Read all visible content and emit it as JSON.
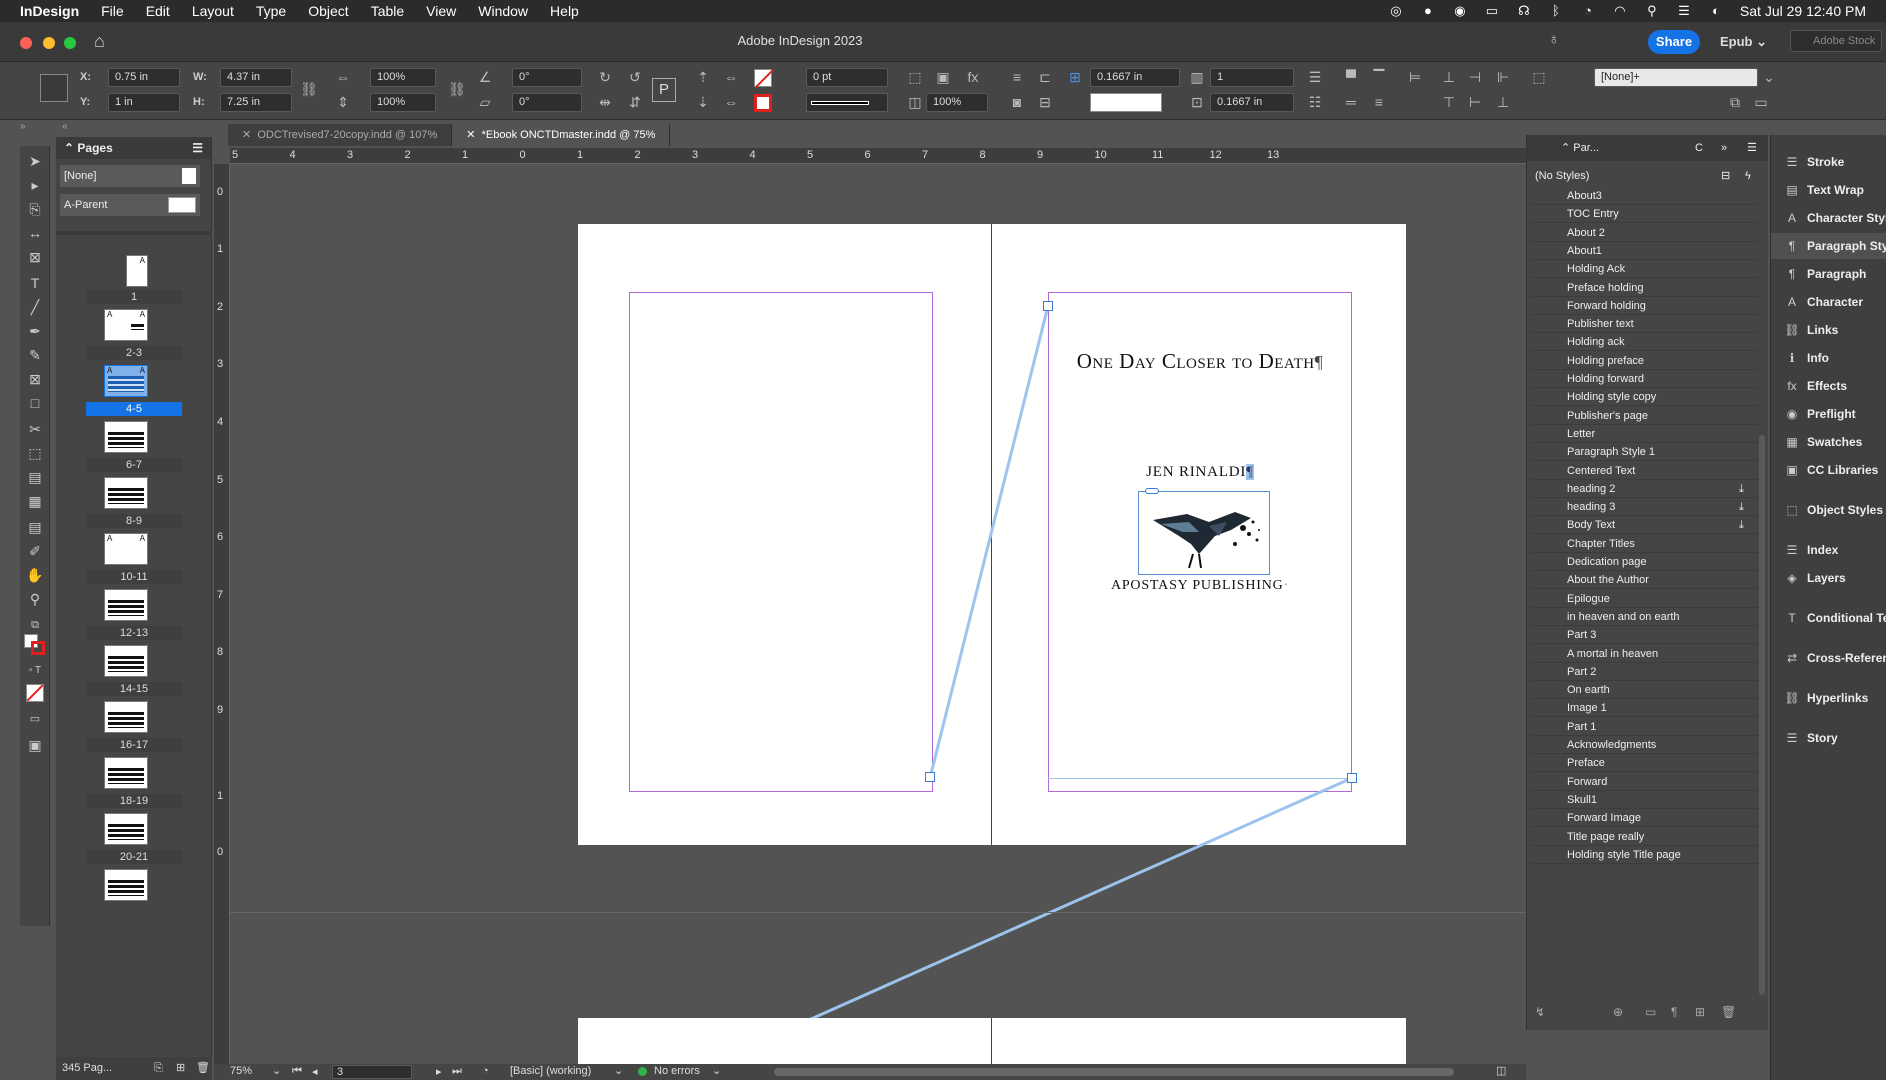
{
  "menubar": {
    "app_name": "InDesign",
    "items": [
      "File",
      "Edit",
      "Layout",
      "Type",
      "Object",
      "Table",
      "View",
      "Window",
      "Help"
    ],
    "datetime": "Sat Jul 29  12:40 PM"
  },
  "titlebar": {
    "title": "Adobe InDesign 2023",
    "share_label": "Share",
    "workspace_label": "Epub",
    "stock_placeholder": "Adobe Stock"
  },
  "control": {
    "x_label": "X:",
    "x_value": "0.75 in",
    "y_label": "Y:",
    "y_value": "1 in",
    "w_label": "W:",
    "w_value": "4.37 in",
    "h_label": "H:",
    "h_value": "7.25 in",
    "scale_x": "100%",
    "scale_y": "100%",
    "rotate": "0°",
    "shear": "0°",
    "stroke_weight": "0 pt",
    "opacity": "100%",
    "gutter_top": "0.1667 in",
    "gutter_bottom": "0.1667 in",
    "columns": "1",
    "object_style": "[None]+"
  },
  "tabs": [
    {
      "label": "ODCTrevised7-20copy.indd @ 107%"
    },
    {
      "label": "*Ebook ONCTDmaster.indd @ 75%"
    }
  ],
  "pages_panel": {
    "title": "Pages",
    "none_label": "[None]",
    "parent_label": "A-Parent",
    "page_labels": [
      "1",
      "2-3",
      "4-5",
      "6-7",
      "8-9",
      "10-11",
      "12-13",
      "14-15",
      "16-17",
      "18-19",
      "20-21"
    ],
    "selected_label": "4-5",
    "footer_count": "345 Pag..."
  },
  "ruler": {
    "h_ticks": [
      "5",
      "4",
      "3",
      "2",
      "1",
      "0",
      "1",
      "2",
      "3",
      "4",
      "5",
      "6",
      "7",
      "8",
      "9",
      "10",
      "11",
      "12",
      "13"
    ],
    "v_ticks": [
      "0",
      "1",
      "2",
      "3",
      "4",
      "5",
      "6",
      "7",
      "8",
      "9",
      "1",
      "0"
    ]
  },
  "document": {
    "book_title": "One Day Closer to Death",
    "author": "JEN RINALDI",
    "publisher": "APOSTASY PUBLISHING"
  },
  "status": {
    "zoom": "75%",
    "page": "3",
    "profile": "[Basic] (working)",
    "errors": "No errors"
  },
  "pstyles_panel": {
    "tab_label": "Par...",
    "tab2_label": "C",
    "none_styles": "(No Styles)",
    "styles": [
      "About3",
      "TOC Entry",
      "About 2",
      "About1",
      "Holding Ack",
      "Preface holding",
      "Forward holding",
      "Publisher text",
      "Holding ack",
      "Holding preface",
      "Holding forward",
      "Holding style copy",
      "Publisher's page",
      "Letter",
      "Paragraph Style 1",
      "Centered Text",
      "heading 2",
      "heading 3",
      "Body Text",
      "Chapter Titles",
      "Dedication page",
      "About the Author",
      "Epilogue",
      "in heaven and on earth",
      "Part 3",
      "A mortal in heaven",
      "Part 2",
      "On earth",
      "Image 1",
      "Part 1",
      "Acknowledgments",
      "Preface",
      "Forward",
      "Skull1",
      "Forward Image",
      "Title page really",
      "Holding style Title page"
    ]
  },
  "dock": {
    "items": [
      {
        "label": "Stroke",
        "icon": "stroke-icon"
      },
      {
        "label": "Text Wrap",
        "icon": "text-wrap-icon"
      },
      {
        "label": "Character Styles",
        "icon": "character-styles-icon"
      },
      {
        "label": "Paragraph Styles",
        "icon": "paragraph-styles-icon"
      },
      {
        "label": "Paragraph",
        "icon": "paragraph-icon"
      },
      {
        "label": "Character",
        "icon": "character-icon"
      },
      {
        "label": "Links",
        "icon": "links-icon"
      },
      {
        "label": "Info",
        "icon": "info-icon"
      },
      {
        "label": "Effects",
        "icon": "effects-icon"
      },
      {
        "label": "Preflight",
        "icon": "preflight-icon"
      },
      {
        "label": "Swatches",
        "icon": "swatches-icon"
      },
      {
        "label": "CC Libraries",
        "icon": "cc-libraries-icon"
      },
      {
        "label": "Object Styles",
        "icon": "object-styles-icon"
      },
      {
        "label": "Index",
        "icon": "index-icon"
      },
      {
        "label": "Layers",
        "icon": "layers-icon"
      },
      {
        "label": "Conditional Text",
        "icon": "conditional-text-icon"
      },
      {
        "label": "Cross-References",
        "icon": "cross-references-icon"
      },
      {
        "label": "Hyperlinks",
        "icon": "hyperlinks-icon"
      },
      {
        "label": "Story",
        "icon": "story-icon"
      }
    ]
  },
  "colors": {
    "accent": "#1473e6",
    "margin_guide": "#b06ad8",
    "frame_link": "#9cc3ec"
  }
}
